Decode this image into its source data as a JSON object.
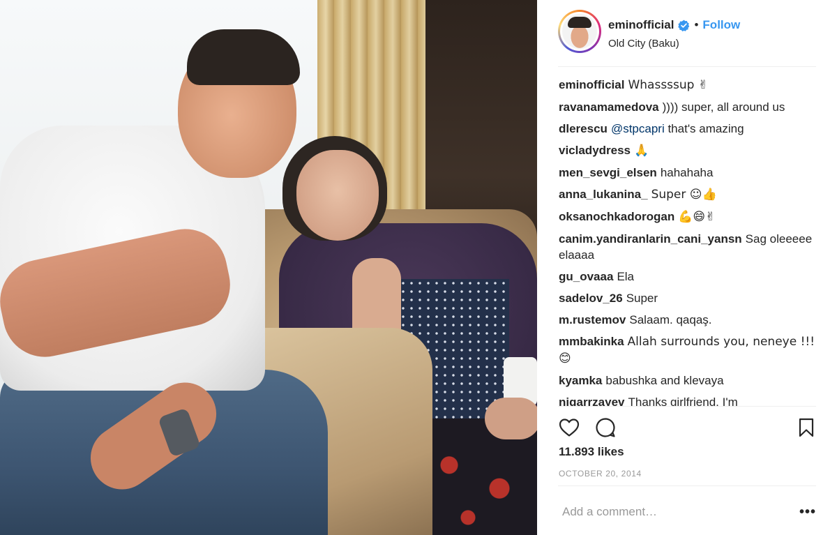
{
  "post": {
    "username": "eminofficial",
    "follow_label": "Follow",
    "separator": "•",
    "location": "Old City (Baku)",
    "likes": "11.893 likes",
    "date": "OCTOBER 20, 2014",
    "comment_placeholder": "Add a comment…",
    "more_label": "•••"
  },
  "comments": [
    {
      "user": "eminofficial",
      "text": "Whassssup ✌"
    },
    {
      "user": "ravanamamedova",
      "text": ")))) super, all around us"
    },
    {
      "user": "dlerescu",
      "mention": "@stpcapri",
      "text": " that's amazing"
    },
    {
      "user": "vicladydress",
      "text": "🙏"
    },
    {
      "user": "men_sevgi_elsen",
      "text": "hahahaha"
    },
    {
      "user": "anna_lukanina_",
      "text": "Super ☺👍"
    },
    {
      "user": "oksanochkadorogan",
      "text": "💪😄✌"
    },
    {
      "user": "canim.yandiranlarin_cani_yansn",
      "text": "Sag oleeeee elaaaa"
    },
    {
      "user": "gu_ovaaa",
      "text": "Ela"
    },
    {
      "user": "sadelov_26",
      "text": "Super"
    },
    {
      "user": "m.rustemov",
      "text": "Salaam. qaqaş."
    },
    {
      "user": "mmbakinka",
      "text": "Allah surrounds you, neneye !!! 😊"
    },
    {
      "user": "kyamka",
      "text": "babushka and klevaya"
    },
    {
      "user": "nigarrzayev",
      "text": "Thanks girlfriend, I'm"
    }
  ],
  "icons": {
    "like": "heart-icon",
    "comment": "speech-bubble-icon",
    "save": "bookmark-icon",
    "verified": "verified-badge-icon"
  },
  "colors": {
    "link_blue": "#3897f0",
    "mention": "#003569",
    "muted": "#999999",
    "text": "#262626"
  }
}
